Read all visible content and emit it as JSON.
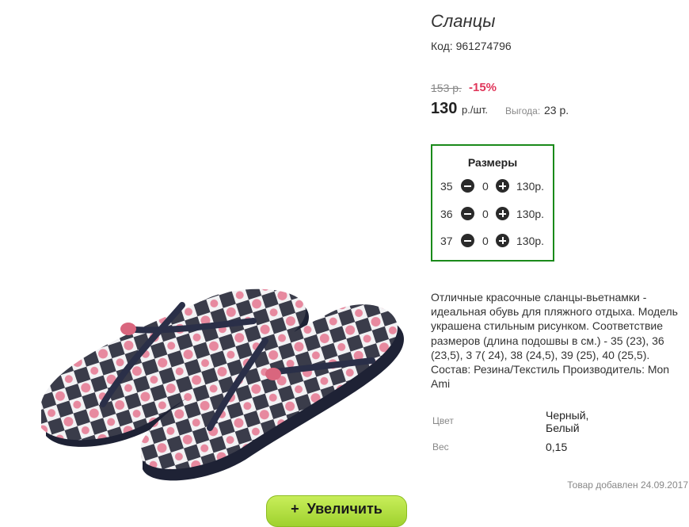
{
  "product": {
    "title": "Сланцы",
    "sku": "Код: 961274796",
    "old_price": "153 р.",
    "discount": "-15%",
    "price": "130",
    "price_unit": "р./шт.",
    "saving_label": "Выгода:",
    "saving_value": "23 р."
  },
  "sizes": {
    "title": "Размеры",
    "rows": [
      {
        "size": "35",
        "qty": "0",
        "price": "130р."
      },
      {
        "size": "36",
        "qty": "0",
        "price": "130р."
      },
      {
        "size": "37",
        "qty": "0",
        "price": "130р."
      }
    ]
  },
  "description": "Отличные красочные сланцы-вьетнамки - идеальная обувь для пляжного отдыха. Модель украшена стильным рисунком. Соответствие размеров (длина подошвы в см.) - 35 (23), 36 (23,5), 3 7( 24), 38 (24,5), 39 (25), 40 (25,5). Состав: Резина/Текстиль Производитель: Mon Ami",
  "attributes": {
    "color_label": "Цвет",
    "color_value_line1": "Черный,",
    "color_value_line2": "Белый",
    "weight_label": "Вес",
    "weight_value": "0,15"
  },
  "added_date": "Товар добавлен 24.09.2017",
  "zoom_button": {
    "icon": "+",
    "label": "Увеличить"
  },
  "colors": {
    "accent_green": "#1a8a1a",
    "discount_red": "#e0365a",
    "button_green": "#a8d83a",
    "ladybug_pink": "#e7899f",
    "sole_navy": "#1e2235"
  }
}
